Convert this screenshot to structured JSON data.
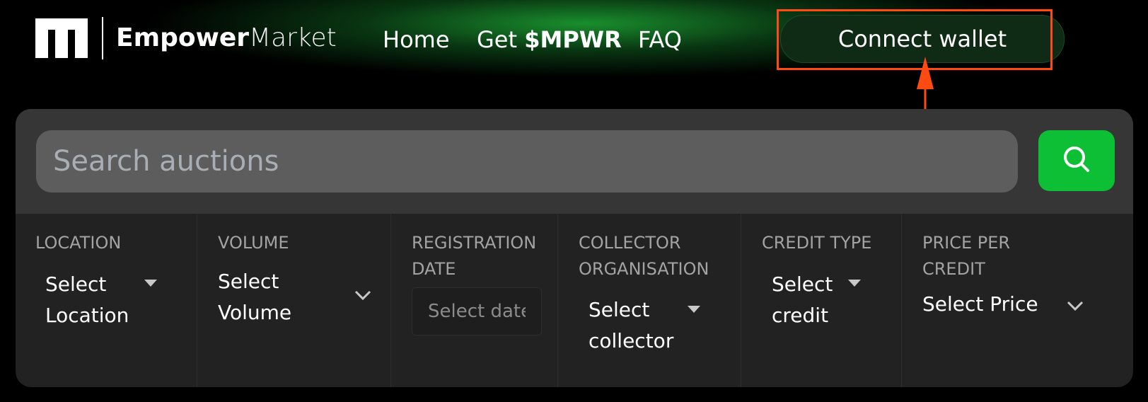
{
  "header": {
    "brand_bold": "Empower",
    "brand_light": "Market",
    "nav": {
      "home": "Home",
      "get_prefix": "Get",
      "get_token": "$MPWR",
      "faq": "FAQ"
    },
    "connect_wallet": "Connect wallet"
  },
  "search": {
    "placeholder": "Search auctions"
  },
  "filters": {
    "location": {
      "label": "LOCATION",
      "value_line1": "Select",
      "value_line2": "Location"
    },
    "volume": {
      "label": "VOLUME",
      "value_line1": "Select",
      "value_line2": "Volume"
    },
    "registration_date": {
      "label_line1": "REGISTRATION",
      "label_line2": "DATE",
      "placeholder": "Select date"
    },
    "collector": {
      "label_line1": "COLLECTOR",
      "label_line2": "ORGANISATION",
      "value_line1": "Select",
      "value_line2": "collector"
    },
    "credit_type": {
      "label": "CREDIT TYPE",
      "value_line1": "Select",
      "value_line2": "credit"
    },
    "price": {
      "label_line1": "PRICE PER",
      "label_line2": "CREDIT",
      "value": "Select Price"
    }
  },
  "colors": {
    "accent_green": "#0cbf34",
    "annotation": "#ff4a12",
    "panel": "#222222"
  }
}
